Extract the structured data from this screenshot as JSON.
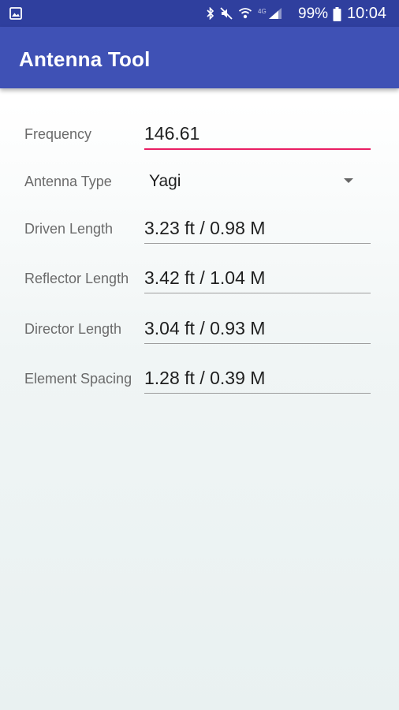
{
  "status_bar": {
    "battery_percent": "99%",
    "time": "10:04",
    "network_label": "4G",
    "icons": [
      "image-icon",
      "bluetooth-icon",
      "mute-icon",
      "wifi-icon",
      "signal-icon",
      "battery-icon"
    ]
  },
  "app_bar": {
    "title": "Antenna Tool",
    "color": "#3f51b5"
  },
  "form": {
    "frequency": {
      "label": "Frequency",
      "value": "146.61"
    },
    "antenna_type": {
      "label": "Antenna Type",
      "value": "Yagi"
    },
    "driven_length": {
      "label": "Driven Length",
      "value": "3.23 ft / 0.98 M"
    },
    "reflector_length": {
      "label": "Reflector Length",
      "value": "3.42 ft / 1.04 M"
    },
    "director_length": {
      "label": "Director Length",
      "value": "3.04 ft / 0.93 M"
    },
    "element_spacing": {
      "label": "Element Spacing",
      "value": "1.28 ft / 0.39 M"
    }
  },
  "colors": {
    "accent": "#e91e63",
    "status_bar": "#2f3f9e"
  }
}
